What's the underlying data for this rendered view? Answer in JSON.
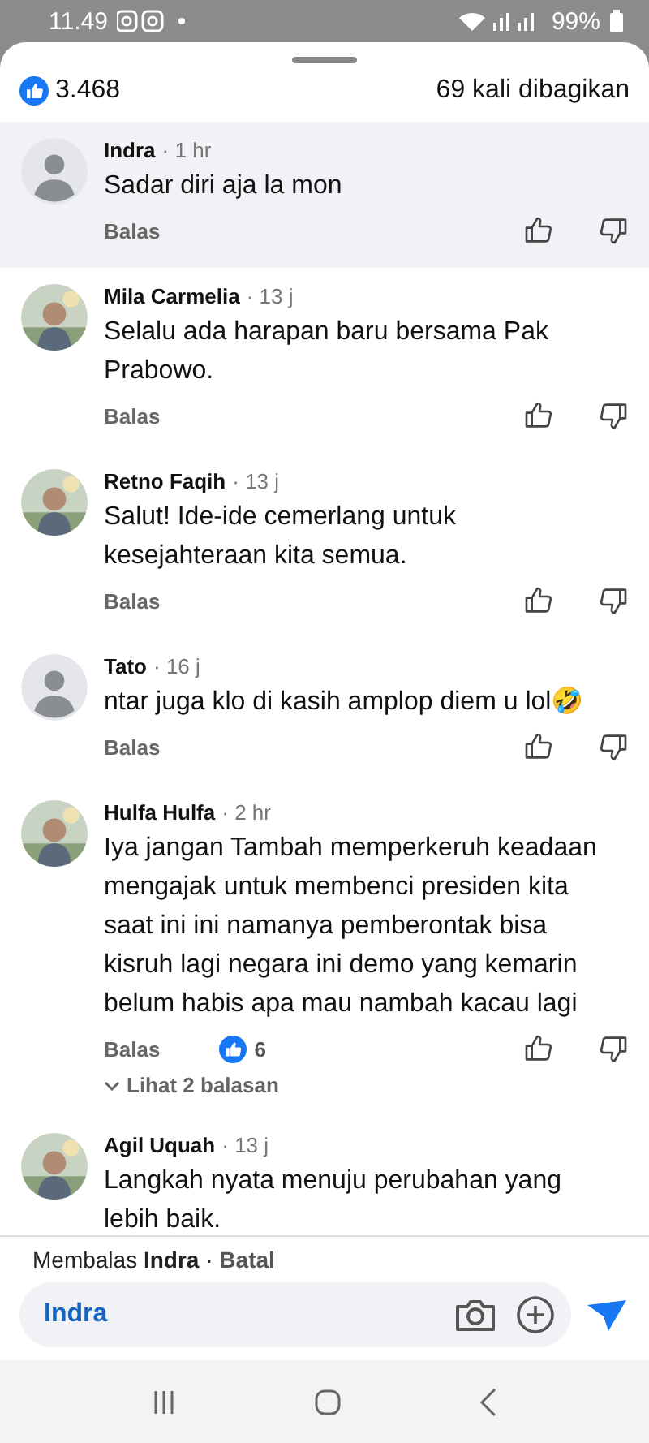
{
  "status_bar": {
    "time": "11.49",
    "battery": "99%"
  },
  "header": {
    "likes": "3.468",
    "shares": "69 kali dibagikan"
  },
  "comments": [
    {
      "author": "Indra",
      "time": "1 hr",
      "text": "Sadar diri aja la mon",
      "avatar": {
        "kind": "default"
      },
      "separator": "·",
      "highlighted": true,
      "reply": "Balas"
    },
    {
      "author": "Mila Carmelia",
      "time": "13 j",
      "text": "Selalu ada harapan baru bersama Pak Prabowo.",
      "separator": "·",
      "highlighted": false,
      "reply": "Balas"
    },
    {
      "author": "Retno Faqih",
      "time": "13 j",
      "text": "Salut! Ide-ide cemerlang untuk kesejahteraan kita semua.",
      "separator": "·",
      "highlighted": false,
      "reply": "Balas"
    },
    {
      "author": "Tato",
      "time": "16 j",
      "text": "ntar juga klo di kasih amplop diem u lol🤣",
      "avatar": {
        "kind": "default"
      },
      "separator": "·",
      "highlighted": false,
      "reply": "Balas"
    },
    {
      "author": "Hulfa Hulfa",
      "time": "2 hr",
      "text": "Iya jangan Tambah memperkeruh keadaan mengajak untuk membenci presiden kita saat ini ini namanya pemberontak bisa kisruh lagi negara ini demo yang kemarin belum habis apa mau nambah kacau lagi",
      "separator": "·",
      "highlighted": false,
      "reply": "Balas",
      "reactions": "6",
      "replies_link": "Lihat 2 balasan"
    },
    {
      "author": "Agil Uquah",
      "time": "13 j",
      "text": "Langkah nyata menuju perubahan yang lebih baik.",
      "separator": "·",
      "highlighted": false
    }
  ],
  "reply_bar": {
    "prefix": "Membalas",
    "target": "Indra",
    "separator": "·",
    "cancel": "Batal",
    "input_value": "Indra"
  }
}
